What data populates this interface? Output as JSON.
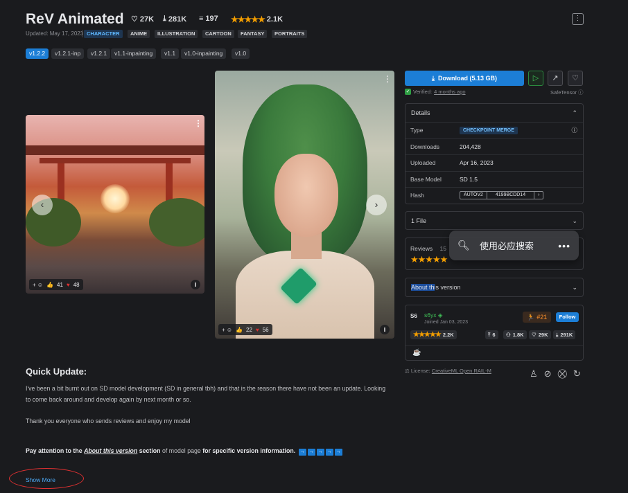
{
  "header": {
    "title": "ReV Animated",
    "likes": "27K",
    "downloads": "281K",
    "comments": "197",
    "rating_count": "2.1K",
    "updated": "Updated: May 17, 2023",
    "tags": [
      "CHARACTER",
      "ANIME",
      "ILLUSTRATION",
      "CARTOON",
      "FANTASY",
      "PORTRAITS"
    ],
    "menu_icon": "⋮"
  },
  "versions": [
    "v1.2.2",
    "v1.2.1-inp",
    "v1.2.1",
    "v1.1-inpainting",
    "v1.1",
    "v1.0-inpainting",
    "v1.0"
  ],
  "gallery": {
    "img1": {
      "likes": "41",
      "hearts": "48"
    },
    "img2": {
      "likes": "22",
      "hearts": "56"
    },
    "prev": "‹",
    "next": "›"
  },
  "download": {
    "label": "Download (5.13 GB)",
    "verified": "Verified:",
    "verified_time": "4 months ago",
    "format": "SafeTensor"
  },
  "details": {
    "heading": "Details",
    "rows": {
      "type_k": "Type",
      "type_v": "CHECKPOINT MERGE",
      "downloads_k": "Downloads",
      "downloads_v": "204,428",
      "uploaded_k": "Uploaded",
      "uploaded_v": "Apr 16, 2023",
      "base_k": "Base Model",
      "base_v": "SD 1.5",
      "hash_k": "Hash",
      "hash_type": "AUTOV2",
      "hash_v": "4199BCDD14"
    }
  },
  "files": {
    "label": "1 File"
  },
  "reviews": {
    "label": "Reviews",
    "count_partial": "15"
  },
  "about": {
    "label_hl": "About th",
    "label_rest": "is version"
  },
  "creator": {
    "avatar": "S6",
    "name": "s6yx",
    "joined": "Joined Jan 03, 2023",
    "rank": "#21",
    "follow": "Follow",
    "rating": "2.2K",
    "uploads": "6",
    "followers": "1.8K",
    "likes": "29K",
    "downloads": "291K"
  },
  "license": {
    "prefix": "License: ",
    "name": "CreativeML Open RAIL-M"
  },
  "popup": {
    "text": "使用必应搜索",
    "more": "•••"
  },
  "description": {
    "heading": "Quick Update:",
    "p1": "I've been a bit burnt out on SD model development (SD in general tbh) and that is the reason there have not been an update. Looking to come back around and develop again by next month or so.",
    "p2": "Thank you everyone who sends reviews and enjoy my model",
    "p3_a": "Pay attention to the ",
    "p3_link": "About this version",
    "p3_b": " section",
    "p3_c": " of model page ",
    "p3_d": "for specific version information.",
    "show_more": "Show More"
  },
  "colors": {
    "accent": "#1c7ed6",
    "bg": "#1a1b1e",
    "star": "#f59f00",
    "success": "#40c057"
  }
}
